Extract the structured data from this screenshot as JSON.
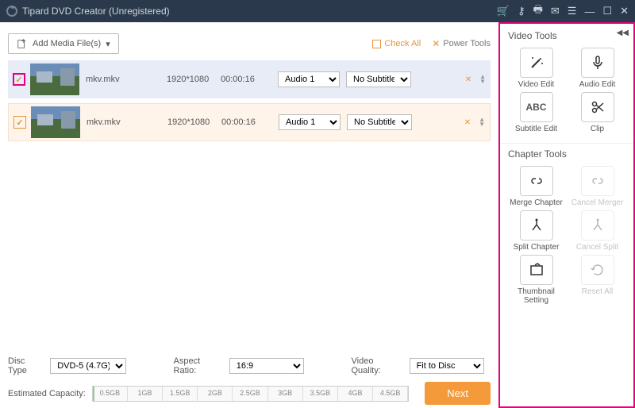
{
  "app_title": "Tipard DVD Creator (Unregistered)",
  "add_btn_label": "Add Media File(s)",
  "check_all_label": "Check All",
  "power_tools_label": "Power Tools",
  "files": [
    {
      "name": "mkv.mkv",
      "resolution": "1920*1080",
      "duration": "00:00:16",
      "audio": "Audio 1",
      "subtitle": "No Subtitle"
    },
    {
      "name": "mkv.mkv",
      "resolution": "1920*1080",
      "duration": "00:00:16",
      "audio": "Audio 1",
      "subtitle": "No Subtitle"
    }
  ],
  "disc_type_label": "Disc Type",
  "disc_type_value": "DVD-5 (4.7G)",
  "aspect_label": "Aspect Ratio:",
  "aspect_value": "16:9",
  "quality_label": "Video Quality:",
  "quality_value": "Fit to Disc",
  "capacity_label": "Estimated Capacity:",
  "capacity_ticks": [
    "0.5GB",
    "1GB",
    "1.5GB",
    "2GB",
    "2.5GB",
    "3GB",
    "3.5GB",
    "4GB",
    "4.5GB"
  ],
  "next_label": "Next",
  "video_tools_header": "Video Tools",
  "chapter_tools_header": "Chapter Tools",
  "tools_video": [
    {
      "label": "Video Edit",
      "icon": "wand"
    },
    {
      "label": "Audio Edit",
      "icon": "mic"
    },
    {
      "label": "Subtitle Edit",
      "icon": "abc"
    },
    {
      "label": "Clip",
      "icon": "scissors"
    }
  ],
  "tools_chapter": [
    {
      "label": "Merge Chapter",
      "icon": "link",
      "disabled": false
    },
    {
      "label": "Cancel Merger",
      "icon": "link",
      "disabled": true
    },
    {
      "label": "Split Chapter",
      "icon": "split",
      "disabled": false
    },
    {
      "label": "Cancel Split",
      "icon": "split",
      "disabled": true
    },
    {
      "label": "Thumbnail Setting",
      "icon": "thumb",
      "disabled": false
    },
    {
      "label": "Reset All",
      "icon": "reset",
      "disabled": true
    }
  ]
}
